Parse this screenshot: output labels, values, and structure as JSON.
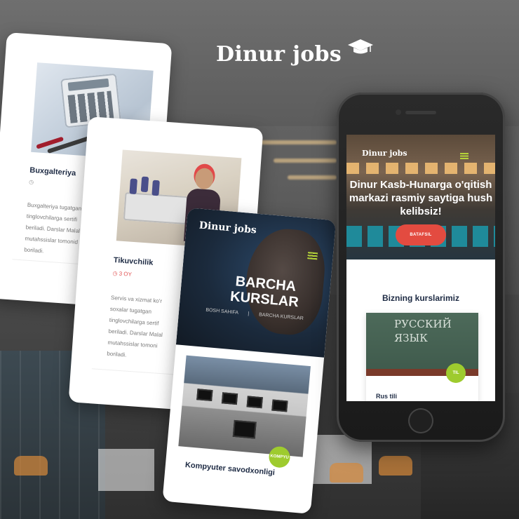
{
  "logo": {
    "text": "Dinur jobs"
  },
  "card_accounting": {
    "title": "Buxgalteriya",
    "meta": "",
    "body": "Buxgalteriya tugatgan\ntinglovchilarga sertifi\nberiladi. Darslar Malal\nmutahssislar tomonid\nboriladi."
  },
  "card_sewing": {
    "title": "Tikuvchilik",
    "meta": "3 OY",
    "body": "Servis va xizmat ko'r\nsoxalar tugatgan\ntinglovchilarga sertif\nberiladi. Darslar Malal\nmutahssislar tomoni\nboriladi."
  },
  "card_courses": {
    "logo": "Dinur jobs",
    "heading": "BARCHA KURSLAR",
    "crumb_home": "BOSH SAHIFA",
    "crumb_sep": "|",
    "crumb_current": "BARCHA KURSLAR",
    "badge": "KOMPYU",
    "title": "Kompyuter savodxonligi"
  },
  "phone": {
    "logo": "Dinur jobs",
    "welcome": "Dinur Kasb-Hunarga o'qitish markazi rasmiy saytiga hush kelibsiz!",
    "button": "BATAFSIL",
    "section_title": "Bizning kurslarimiz",
    "course_board_text": "РУССКИЙ\nЯЗЫК",
    "course_badge": "TIL",
    "course_title": "Rus tili"
  },
  "colors": {
    "accent_green": "#9ecb2e",
    "accent_red": "#e34b40",
    "navy": "#1e2b44"
  },
  "icons": [
    "graduation-cap-icon",
    "hamburger-menu-icon",
    "clock-icon"
  ]
}
